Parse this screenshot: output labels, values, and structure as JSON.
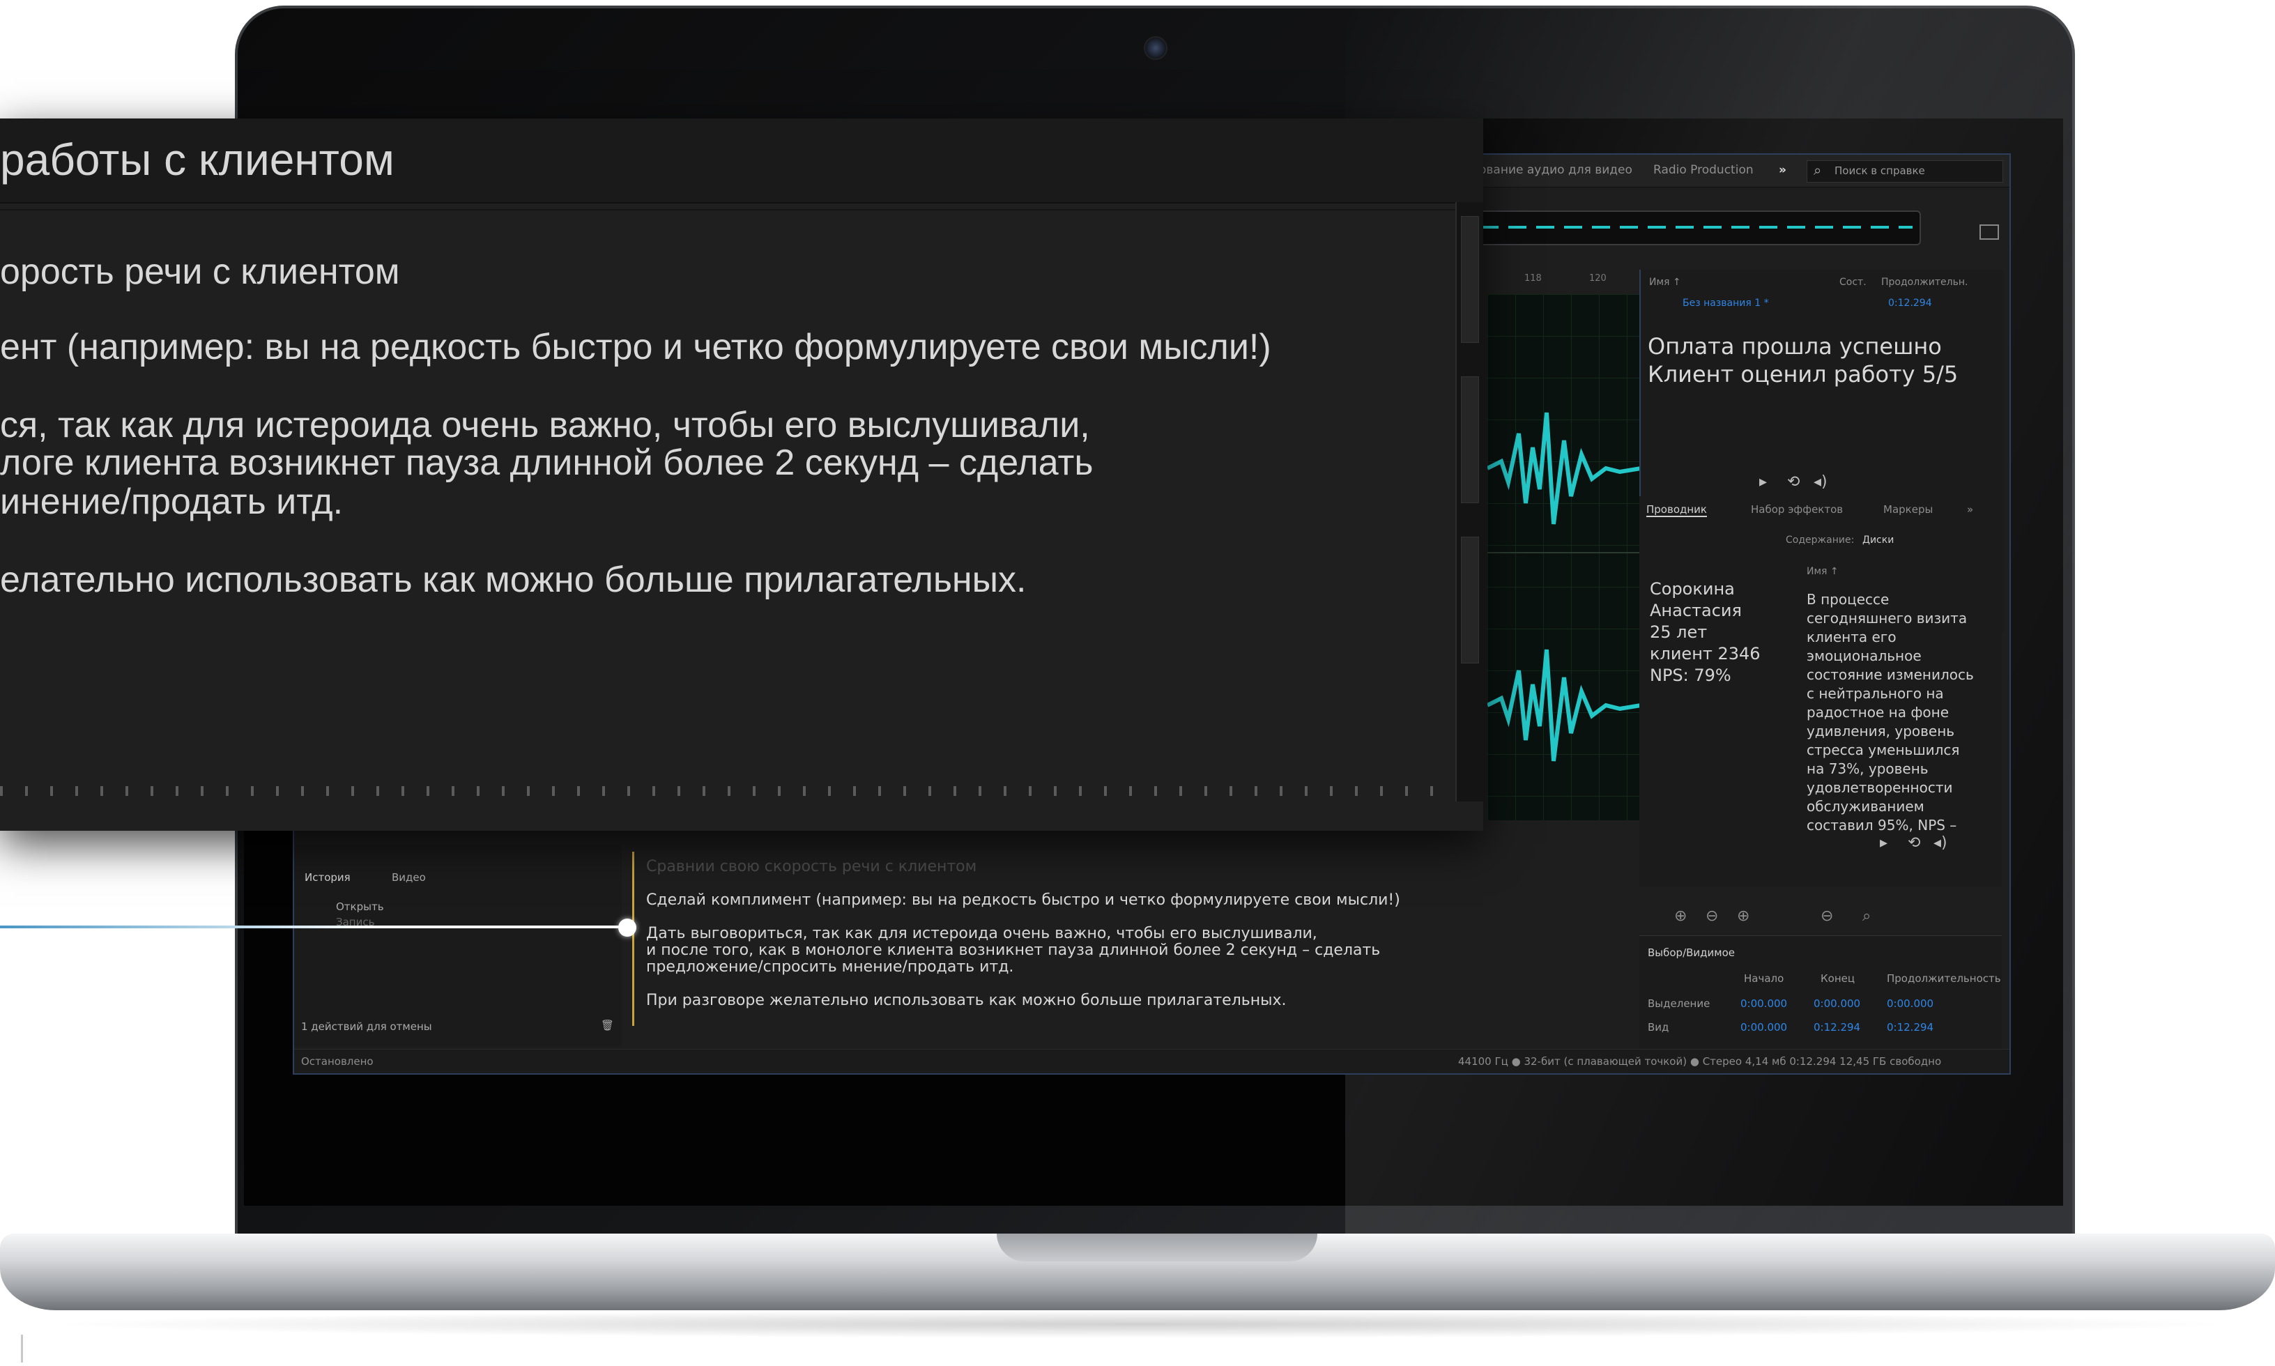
{
  "overlay": {
    "title": "работы с клиентом",
    "lines": [
      "орость речи с клиентом",
      "ент (например: вы на редкость быстро и четко формулируете свои мысли!)",
      "ся,  так как для истероида очень важно, чтобы его выслушивали,",
      "логе клиента возникнет пауза длинной   более 2 секунд – сделать",
      "инение/продать итд.",
      "елательно использовать  как можно больше  прилагательных."
    ]
  },
  "app": {
    "workspaces": [
      "ование аудио для видео",
      "Radio Production",
      "»"
    ],
    "search_placeholder": "Поиск в справке",
    "ruler_labels": [
      "118",
      "120"
    ],
    "files": {
      "col_name": "Имя ↑",
      "col_state": "Сост.",
      "col_duration": "Продолжительн.",
      "file_name": "Без названия 1 *",
      "file_duration": "0:12.294",
      "note": "Оплата прошла успешно Клиент оценил работу 5/5"
    },
    "browser": {
      "tabs": [
        "Проводник",
        "Набор эффектов",
        "Маркеры",
        "»"
      ],
      "content_label": "Содержание:",
      "content_value": "Диски",
      "col_name": "Имя ↑",
      "client_info": "Сорокина Анастасия 25 лет клиент 2346 NPS: 79%",
      "description": "В процессе сегодняшнего визита клиента его эмоциональное состояние изменилось с нейтрального на радостное на фоне удивления, уровень стресса уменьшился на 73%, уровень удовлетворенности обслуживанием составил 95%, NPS –"
    },
    "selection": {
      "title": "Выбор/Видимое",
      "col_start": "Начало",
      "col_end": "Конец",
      "col_duration": "Продолжительность",
      "row1_label": "Выделение",
      "row1": [
        "0:00.000",
        "0:00.000",
        "0:00.000"
      ],
      "row2_label": "Вид",
      "row2": [
        "0:00.000",
        "0:12.294",
        "0:12.294"
      ]
    },
    "history": {
      "tabs": [
        "История",
        "Видео"
      ],
      "items": [
        "Открыть",
        "Запись"
      ],
      "footer": "1 действий для отмены"
    },
    "script": [
      "Сравнии свою скорость речи с клиентом",
      "Сделай  комплимент (например: вы на редкость быстро и четко формулируете свои мысли!)",
      "Дать выговориться,  так как для истероида очень важно, чтобы его выслушивали,",
      "и после того, как в монологе клиента возникнет пауза длинной   более 2 секунд – сделать",
      "предложение/спросить мнение/продать итд.",
      "При разговоре желательно использовать  как можно больше  прилагательных."
    ],
    "status": {
      "left": "Остановлено",
      "right": "44100 Гц ● 32-бит (с плавающей точкой) ● Стерео    4,14 мб     0:12.294    12,45 ГБ свободно"
    },
    "colors": {
      "accent_blue": "#2f86e6",
      "waveform": "#24c7c7",
      "script_bar": "#c9a43a"
    }
  }
}
